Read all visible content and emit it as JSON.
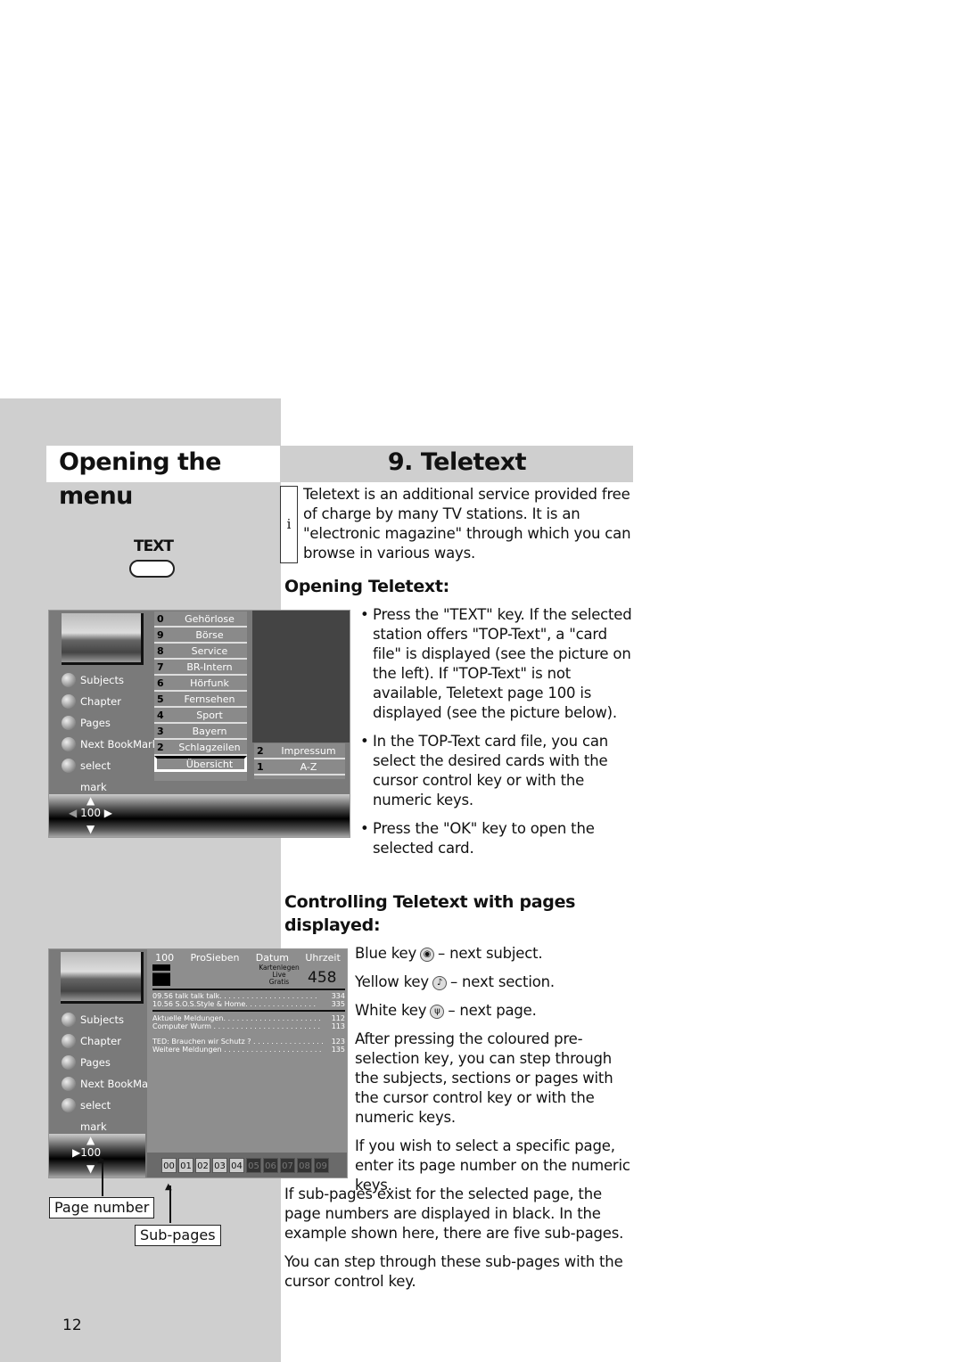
{
  "header": {
    "left_title": "Opening the menu",
    "right_title": "9. Teletext"
  },
  "info": {
    "icon": "i",
    "text": "Teletext is an additional service provided free of charge by many TV stations. It is an \"electronic magazine\" through which you can browse in various ways."
  },
  "remote": {
    "text_key_label": "TEXT"
  },
  "opening": {
    "heading": "Opening Teletext:",
    "bullets": [
      "Press the \"TEXT\" key. If the selected station offers \"TOP-Text\", a \"card file\" is displayed (see the picture on the left). If \"TOP-Text\" is not available, Teletext page 100 is displayed (see the picture below).",
      "In the TOP-Text card file, you can select the desired cards with the cursor control key or with the numeric keys.",
      "Press the \"OK\" key to open the selected card."
    ]
  },
  "controlling": {
    "heading": "Controlling Teletext with pages displayed:",
    "keys": [
      {
        "key": "Blue key",
        "icon": "eye-icon",
        "action": "– next subject."
      },
      {
        "key": "Yellow key",
        "icon": "music-note-icon",
        "action": "– next section."
      },
      {
        "key": "White key",
        "icon": "antenna-icon",
        "action": "– next page."
      }
    ],
    "paragraphs": [
      "After pressing the coloured pre-selection key, you can step through the subjects, sections or pages with the cursor control key or with the numeric keys.",
      "If you wish to select a specific page, enter its page number on the numeric keys.",
      "If sub-pages exist for the selected page, the page numbers are displayed in black. In the example shown here, there are five sub-pages.",
      "You can step through these sub-pages with the cursor control key."
    ]
  },
  "screen1": {
    "side": [
      "Subjects",
      "Chapter",
      "Pages",
      "Next BookMark",
      "select"
    ],
    "mark": "mark",
    "page": "100",
    "cards": [
      {
        "n": "0",
        "t": "Gehörlose"
      },
      {
        "n": "9",
        "t": "Börse"
      },
      {
        "n": "8",
        "t": "Service"
      },
      {
        "n": "7",
        "t": "BR-Intern"
      },
      {
        "n": "6",
        "t": "Hörfunk"
      },
      {
        "n": "5",
        "t": "Fernsehen"
      },
      {
        "n": "4",
        "t": "Sport"
      },
      {
        "n": "3",
        "t": "Bayern"
      },
      {
        "n": "2",
        "t": "Schlagzeilen"
      },
      {
        "n": "",
        "t": "Übersicht"
      }
    ],
    "cards2": [
      {
        "n": "2",
        "t": "Impressum"
      },
      {
        "n": "1",
        "t": "A-Z"
      }
    ]
  },
  "screen2": {
    "side": [
      "Subjects",
      "Chapter",
      "Pages",
      "Next BookMar",
      "select"
    ],
    "mark": "mark",
    "page": "100",
    "top": {
      "page": "100",
      "station": "ProSieben",
      "date": "Datum",
      "time": "Uhrzeit",
      "promo": [
        "Kartenlegen",
        "Live",
        "Gratis"
      ],
      "number": "458"
    },
    "lines1": [
      {
        "t": "09.56   talk talk talk. . . . . . . . . . . . . . . . . . . . . .",
        "p": "334"
      },
      {
        "t": "10.56   S.O.S.Style & Home. . . . . . . . . . . . . . . .",
        "p": "335"
      }
    ],
    "lines2": [
      {
        "t": "Aktuelle Meldungen. . . . . . . . . . . . . . . . . . . . . .",
        "p": "112"
      },
      {
        "t": "Computer Wurm . . . . . . . . . . . . . . . . . . . . . . . .",
        "p": "113"
      }
    ],
    "lines3": [
      {
        "t": "TED: Brauchen wir Schutz ? . . . . . . . . . . . . . . . .",
        "p": "123"
      },
      {
        "t": "Weitere Meldungen . . . . . . . . . . . . . . . . . . . . . .",
        "p": "135"
      }
    ],
    "subpages": [
      "00",
      "01",
      "02",
      "03",
      "04",
      "05",
      "06",
      "07",
      "08",
      "09"
    ]
  },
  "labels": {
    "page_number": "Page number",
    "sub_pages": "Sub-pages"
  },
  "footer": {
    "page": "12"
  }
}
